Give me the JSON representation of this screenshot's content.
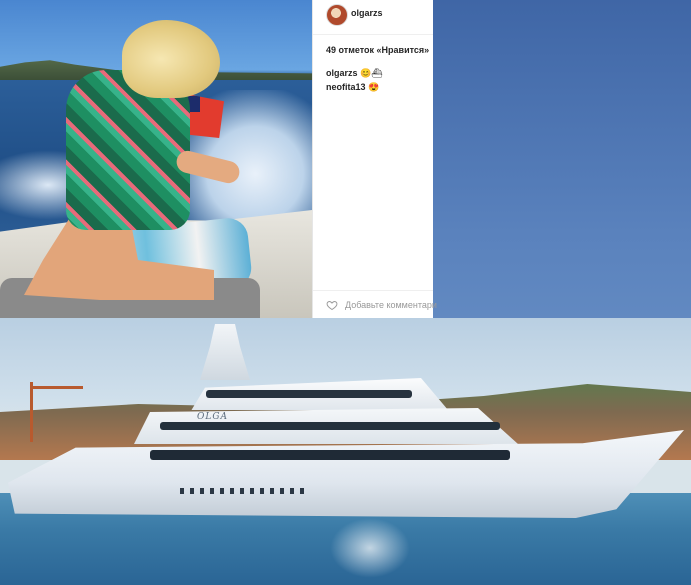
{
  "post": {
    "username": "olgarzs",
    "likes_text": "49 отметок «Нравится»",
    "comments": [
      {
        "author": "olgarzs",
        "text": "😊⛴"
      },
      {
        "author": "neofita13",
        "text": "😍"
      }
    ],
    "add_comment_placeholder": "Добавьте комментари"
  },
  "yacht": {
    "name": "OLGA"
  },
  "icons": {
    "like": "heart-icon",
    "avatar": "avatar"
  },
  "colors": {
    "panel_bg": "#ffffff",
    "text": "#262626",
    "muted": "#999999",
    "page_bg": "#5a82bd"
  }
}
